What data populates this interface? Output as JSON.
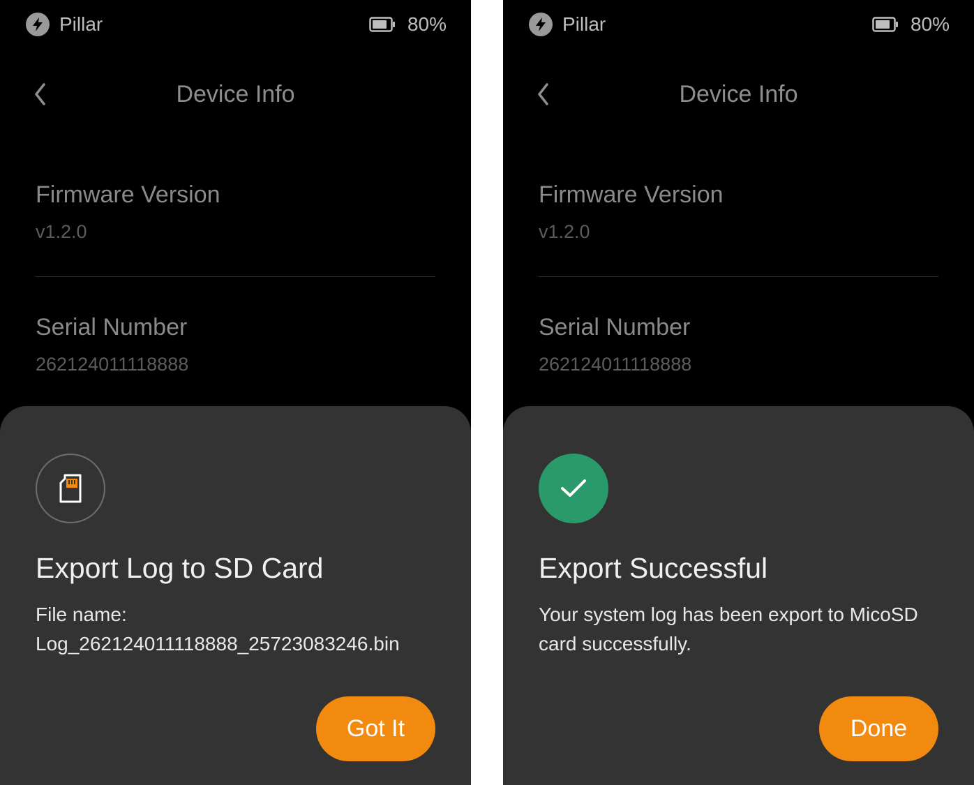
{
  "screens": [
    {
      "status_bar": {
        "app_name": "Pillar",
        "app_icon": "bolt-icon",
        "battery_icon": "battery-icon",
        "battery_percent": "80%"
      },
      "nav": {
        "back_icon": "chevron-left-icon",
        "title": "Device Info"
      },
      "info": [
        {
          "label": "Firmware Version",
          "value": "v1.2.0"
        },
        {
          "label": "Serial Number",
          "value": "262124011118888"
        }
      ],
      "sheet": {
        "icon": "sd-card-icon",
        "title": "Export Log to SD Card",
        "body_line1": "File name:",
        "body_line2": "Log_262124011118888_25723083246.bin",
        "button_label": "Got It"
      }
    },
    {
      "status_bar": {
        "app_name": "Pillar",
        "app_icon": "bolt-icon",
        "battery_icon": "battery-icon",
        "battery_percent": "80%"
      },
      "nav": {
        "back_icon": "chevron-left-icon",
        "title": "Device Info"
      },
      "info": [
        {
          "label": "Firmware Version",
          "value": "v1.2.0"
        },
        {
          "label": "Serial Number",
          "value": "262124011118888"
        }
      ],
      "sheet": {
        "icon": "check-icon",
        "title": "Export Successful",
        "body_line1": "Your system log has been export to MicoSD",
        "body_line2": "card successfully.",
        "button_label": "Done"
      }
    }
  ],
  "colors": {
    "accent": "#f28a10",
    "success": "#2a9a6a",
    "sheet_background": "#333333",
    "screen_background": "#000000"
  }
}
